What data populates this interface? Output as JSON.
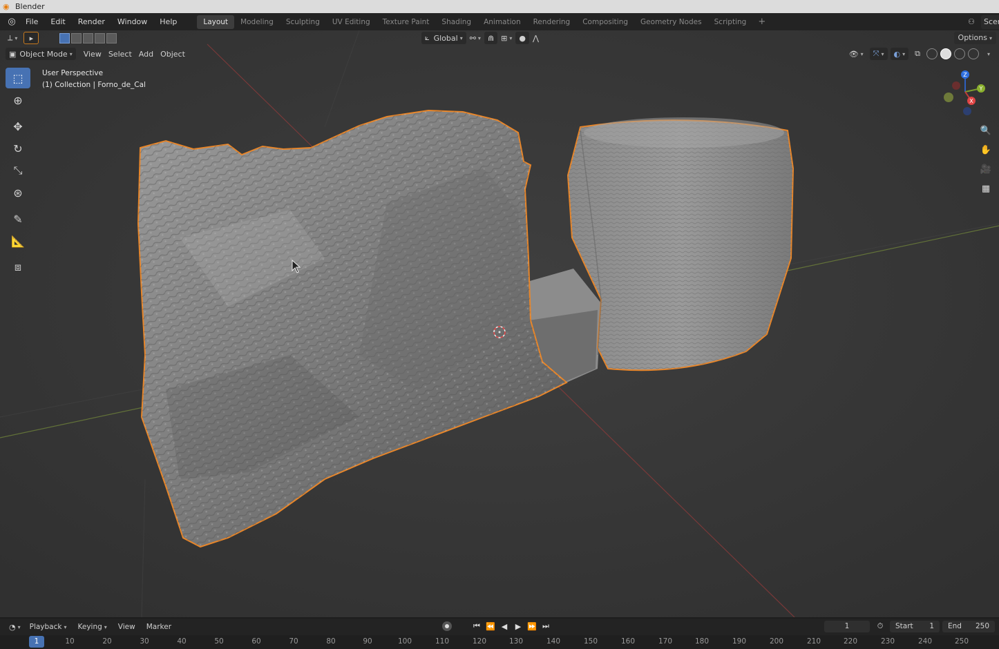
{
  "window": {
    "title": "Blender"
  },
  "menu": {
    "items": [
      "File",
      "Edit",
      "Render",
      "Window",
      "Help"
    ]
  },
  "workspaces": {
    "tabs": [
      "Layout",
      "Modeling",
      "Sculpting",
      "UV Editing",
      "Texture Paint",
      "Shading",
      "Animation",
      "Rendering",
      "Compositing",
      "Geometry Nodes",
      "Scripting"
    ],
    "active": "Layout",
    "add": "+"
  },
  "scene": {
    "name": "Scer"
  },
  "tool_header": {
    "orientation": "Global",
    "options": "Options"
  },
  "view_header": {
    "mode": "Object Mode",
    "menus": [
      "View",
      "Select",
      "Add",
      "Object"
    ]
  },
  "viewport": {
    "perspective": "User Perspective",
    "collection": "(1) Collection | Forno_de_Cal"
  },
  "gizmo": {
    "x": "X",
    "y": "Y",
    "z": "Z"
  },
  "timeline": {
    "menus": [
      "Playback",
      "Keying",
      "View",
      "Marker"
    ],
    "current_frame": "1",
    "start_label": "Start",
    "start": "1",
    "end_label": "End",
    "end": "250",
    "ruler": [
      "1",
      "10",
      "20",
      "30",
      "40",
      "50",
      "60",
      "70",
      "80",
      "90",
      "100",
      "110",
      "120",
      "130",
      "140",
      "150",
      "160",
      "170",
      "180",
      "190",
      "200",
      "210",
      "220",
      "230",
      "240",
      "250"
    ]
  },
  "colors": {
    "accent": "#4772b3",
    "selection_outline": "#e8862a",
    "viewport_bg": "#3a3a3a"
  }
}
